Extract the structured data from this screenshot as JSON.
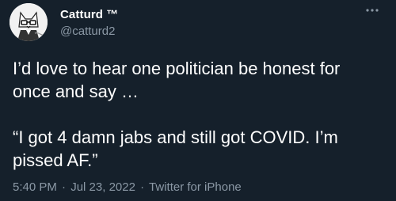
{
  "author": {
    "display_name": "Catturd ™",
    "handle": "@catturd2"
  },
  "tweet": {
    "text": "I’d love to hear one politician be honest for\nonce and say …\n\n“I got 4 damn jabs and still got COVID. I’m\npissed AF.”"
  },
  "meta": {
    "time": "5:40 PM",
    "date": "Jul 23, 2022",
    "source": "Twitter for iPhone",
    "separator": "·"
  },
  "icons": {
    "more": "more-icon",
    "avatar": "cat-avatar"
  },
  "colors": {
    "background": "#15202b",
    "primary_text": "#ffffff",
    "secondary_text": "#8b98a5"
  }
}
